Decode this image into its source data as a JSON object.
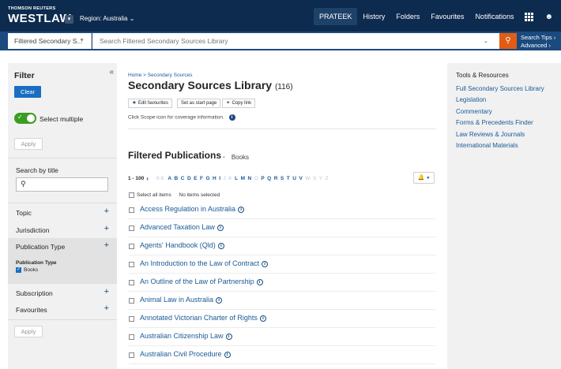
{
  "header": {
    "brand_small": "THOMSON REUTERS",
    "brand_big": "WESTLAW",
    "region": "Region: Australia",
    "nav": [
      "PRATEEK",
      "History",
      "Folders",
      "Favourites",
      "Notifications"
    ]
  },
  "search": {
    "scope": "Filtered Secondary S...",
    "placeholder": "Search Filtered Secondary Sources Library",
    "tips": "Search Tips",
    "advanced": "Advanced"
  },
  "filter": {
    "title": "Filter",
    "clear": "Clear",
    "select_multiple": "Select multiple",
    "apply": "Apply",
    "search_by_title": "Search by title",
    "facets": [
      "Topic",
      "Jurisdiction",
      "Publication Type",
      "Subscription",
      "Favourites"
    ],
    "publication_type_heading": "Publication Type",
    "publication_type_value": "Books"
  },
  "main": {
    "breadcrumb": "Home > Secondary Sources",
    "title": "Secondary Sources Library",
    "count": "(116)",
    "actions": [
      "Edit favourites",
      "Set as start page",
      "Copy link"
    ],
    "scope_note": "Click Scope icon for coverage information.",
    "section_title": "Filtered Publications",
    "section_filter": "Books",
    "range": "1 - 100",
    "digits": "0-9",
    "letters": [
      "A",
      "B",
      "C",
      "D",
      "E",
      "F",
      "G",
      "H",
      "I",
      "J",
      "K",
      "L",
      "M",
      "N",
      "O",
      "P",
      "Q",
      "R",
      "S",
      "T",
      "U",
      "V",
      "W",
      "X",
      "Y",
      "Z"
    ],
    "disabled_letters": [
      "J",
      "K",
      "O",
      "W",
      "X",
      "Y",
      "Z"
    ],
    "select_all": "Select all items",
    "no_items": "No items selected",
    "publications": [
      "Access Regulation in Australia",
      "Advanced Taxation Law",
      "Agents' Handbook (Qld)",
      "An Introduction to the Law of Contract",
      "An Outline of the Law of Partnership",
      "Animal Law in Australia",
      "Annotated Victorian Charter of Rights",
      "Australian Citizenship Law",
      "Australian Civil Procedure"
    ]
  },
  "rail": {
    "title": "Tools & Resources",
    "links": [
      "Full Secondary Sources Library",
      "Legislation",
      "Commentary",
      "Forms & Precedents Finder",
      "Law Reviews & Journals",
      "International Materials"
    ]
  },
  "colors": {
    "header_bg": "#0d2b4f",
    "searchbar_bg": "#1a4a7e",
    "search_button": "#e35c13",
    "link": "#1a5a96",
    "toggle_on": "#3a9d23",
    "primary_button": "#1a6ec2"
  },
  "icons": [
    "grid-icon",
    "user-icon",
    "search-icon",
    "star-icon",
    "link-icon",
    "info-icon",
    "bell-icon",
    "plus-icon",
    "double-chevron-left-icon",
    "chevron-right-icon"
  ]
}
